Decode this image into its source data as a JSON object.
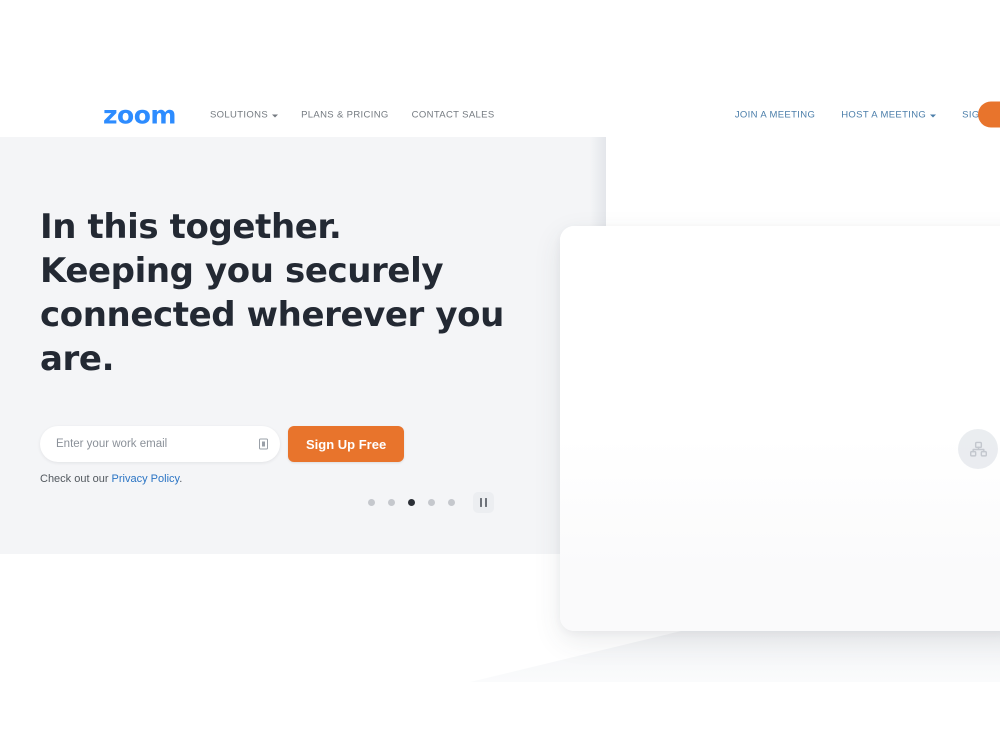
{
  "brand": {
    "logo_text": "zoom",
    "logo_color": "#2d8cff",
    "accent_orange": "#e8742c",
    "link_blue": "#2a74c4",
    "hero_bg": "#f4f5f7",
    "headline_color": "#232933"
  },
  "header": {
    "nav_left": [
      {
        "label": "SOLUTIONS",
        "has_caret": true
      },
      {
        "label": "PLANS & PRICING",
        "has_caret": false
      },
      {
        "label": "CONTACT SALES",
        "has_caret": false
      }
    ],
    "nav_right": [
      {
        "label": "JOIN A MEETING",
        "has_caret": false
      },
      {
        "label": "HOST A MEETING",
        "has_caret": true
      },
      {
        "label": "SIGN IN",
        "has_caret": false
      }
    ],
    "signup_pill_label": ""
  },
  "hero": {
    "headline_line1": "In this together.",
    "headline_line2": "Keeping you securely",
    "headline_line3": "connected wherever you are.",
    "email_placeholder": "Enter your work email",
    "email_value": "",
    "email_info_icon": "info-card-icon",
    "signup_button": "Sign Up Free",
    "privacy_prefix": "Check out our ",
    "privacy_link": "Privacy Policy",
    "privacy_suffix": "."
  },
  "carousel": {
    "total_slides": 5,
    "active_index": 2,
    "pause_icon": "pause-icon"
  },
  "media": {
    "badge_icon": "share-network-icon"
  }
}
